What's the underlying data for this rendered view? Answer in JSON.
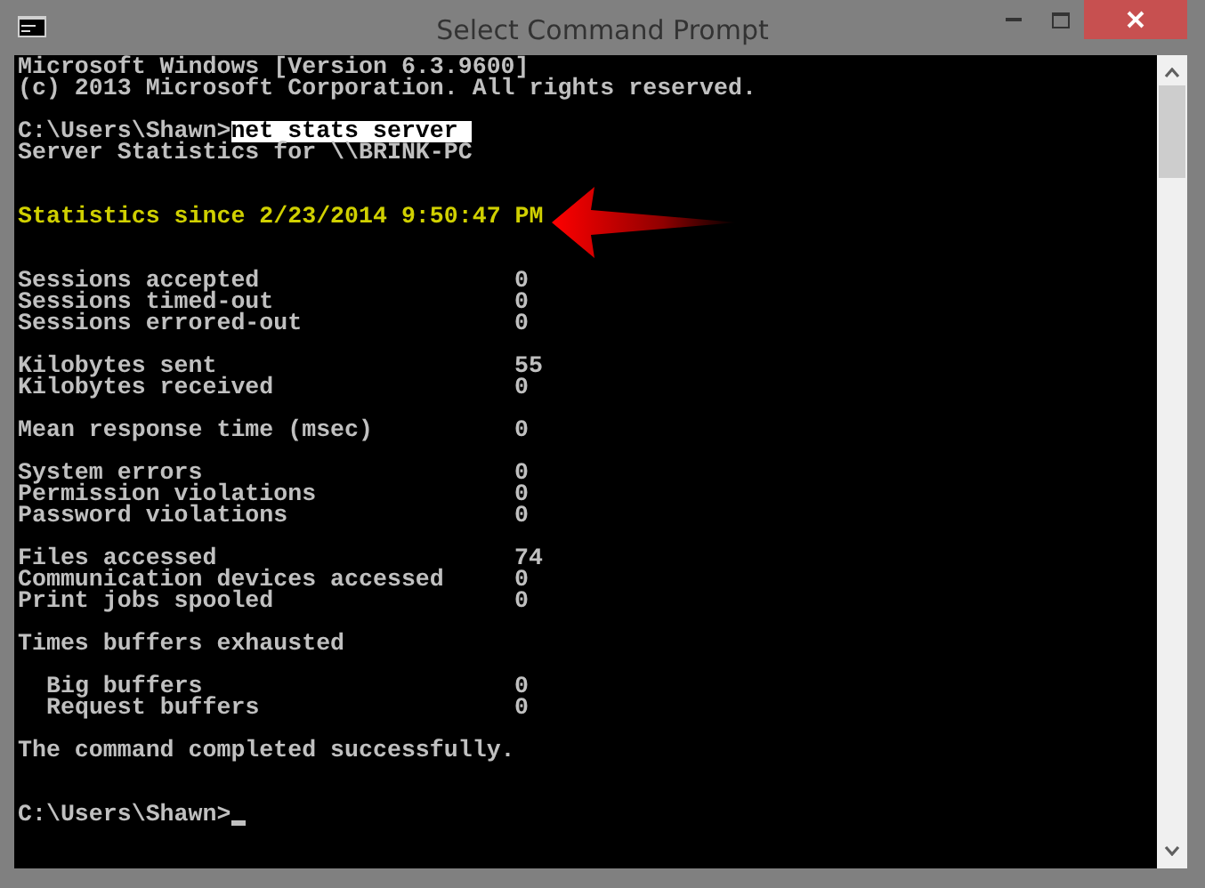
{
  "window": {
    "title": "Select Command Prompt"
  },
  "console": {
    "lines": [
      {
        "kind": "text",
        "text": "Microsoft Windows [Version 6.3.9600]"
      },
      {
        "kind": "text",
        "text": "(c) 2013 Microsoft Corporation. All rights reserved."
      },
      {
        "kind": "blank"
      },
      {
        "kind": "prompt",
        "prompt": "C:\\Users\\Shawn>",
        "command": "net stats server",
        "selected": true
      },
      {
        "kind": "text",
        "text": "Server Statistics for \\\\BRINK-PC"
      },
      {
        "kind": "blank"
      },
      {
        "kind": "blank"
      },
      {
        "kind": "highlight",
        "text": "Statistics since 2/23/2014 9:50:47 PM"
      },
      {
        "kind": "blank"
      },
      {
        "kind": "blank"
      },
      {
        "kind": "stat",
        "label": "Sessions accepted",
        "value": "0",
        "indented": false
      },
      {
        "kind": "stat",
        "label": "Sessions timed-out",
        "value": "0",
        "indented": false
      },
      {
        "kind": "stat",
        "label": "Sessions errored-out",
        "value": "0",
        "indented": false
      },
      {
        "kind": "blank"
      },
      {
        "kind": "stat",
        "label": "Kilobytes sent",
        "value": "55",
        "indented": false
      },
      {
        "kind": "stat",
        "label": "Kilobytes received",
        "value": "0",
        "indented": false
      },
      {
        "kind": "blank"
      },
      {
        "kind": "stat",
        "label": "Mean response time (msec)",
        "value": "0",
        "indented": false
      },
      {
        "kind": "blank"
      },
      {
        "kind": "stat",
        "label": "System errors",
        "value": "0",
        "indented": false
      },
      {
        "kind": "stat",
        "label": "Permission violations",
        "value": "0",
        "indented": false
      },
      {
        "kind": "stat",
        "label": "Password violations",
        "value": "0",
        "indented": false
      },
      {
        "kind": "blank"
      },
      {
        "kind": "stat",
        "label": "Files accessed",
        "value": "74",
        "indented": false
      },
      {
        "kind": "stat",
        "label": "Communication devices accessed",
        "value": "0",
        "indented": false
      },
      {
        "kind": "stat",
        "label": "Print jobs spooled",
        "value": "0",
        "indented": false
      },
      {
        "kind": "blank"
      },
      {
        "kind": "text",
        "text": "Times buffers exhausted"
      },
      {
        "kind": "blank"
      },
      {
        "kind": "stat",
        "label": "Big buffers",
        "value": "0",
        "indented": true
      },
      {
        "kind": "stat",
        "label": "Request buffers",
        "value": "0",
        "indented": true
      },
      {
        "kind": "blank"
      },
      {
        "kind": "text",
        "text": "The command completed successfully."
      },
      {
        "kind": "blank"
      },
      {
        "kind": "blank"
      },
      {
        "kind": "prompt",
        "prompt": "C:\\Users\\Shawn>",
        "cursor": true
      }
    ]
  }
}
